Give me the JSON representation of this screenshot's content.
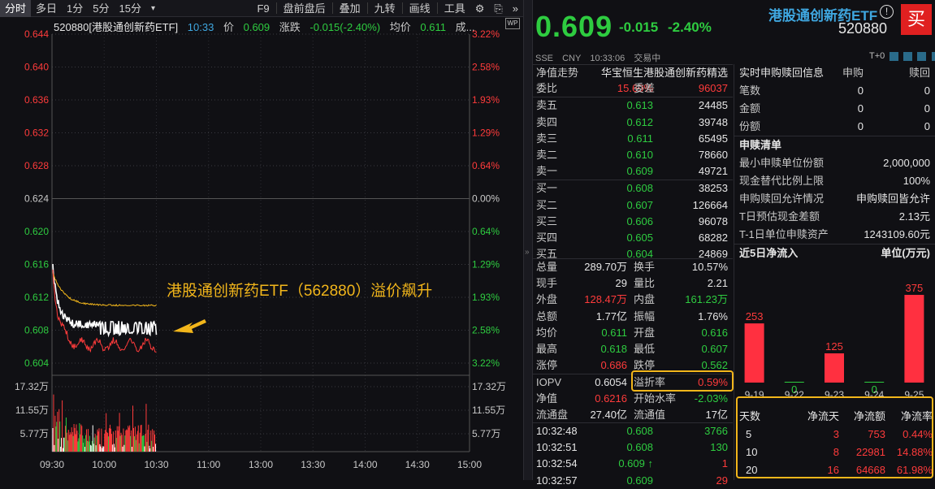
{
  "toolbar": {
    "items": [
      "分时",
      "多日",
      "1分",
      "5分",
      "15分",
      "▾",
      "F9",
      "盘前盘后",
      "叠加",
      "九转",
      "画线",
      "工具",
      "⚙",
      "⎘",
      "»"
    ]
  },
  "chart_info": {
    "code_name": "520880[港股通创新药ETF]",
    "time": "10:33",
    "price_label": "价",
    "price": "0.609",
    "chg_label": "涨跌",
    "chg": "-0.015(-2.40%)",
    "avg_label": "均价",
    "avg": "0.611",
    "vol_label": "成..."
  },
  "annotation": "港股通创新药ETF（562880）溢价飙升",
  "chart_data": {
    "type": "line",
    "price_axis_left": [
      "0.644",
      "0.640",
      "0.636",
      "0.632",
      "0.628",
      "0.624",
      "0.620",
      "0.616",
      "0.612",
      "0.608",
      "0.604"
    ],
    "price_axis_right": [
      "3.22%",
      "2.58%",
      "1.93%",
      "1.29%",
      "0.64%",
      "0.00%",
      "0.64%",
      "1.29%",
      "1.93%",
      "2.58%",
      "3.22%"
    ],
    "volume_axis": [
      "17.32万",
      "11.55万",
      "5.77万"
    ],
    "x_ticks": [
      "09:30",
      "10:00",
      "10:30",
      "11:00",
      "13:00",
      "13:30",
      "14:00",
      "14:30",
      "15:00"
    ],
    "ylim": [
      0.604,
      0.644
    ],
    "prev_close": 0.624,
    "series": [],
    "colors": {
      "up": "#ff3b3b",
      "down": "#2ecc40",
      "neutral": "#ffffff",
      "avg": "#f2b61b"
    }
  },
  "quote": {
    "price": "0.609",
    "change": "-0.015",
    "change_pct": "-2.40%",
    "name": "港股通创新药ETF",
    "code": "520880",
    "buy_label": "买",
    "exchange": "SSE",
    "currency": "CNY",
    "time": "10:33:06",
    "status": "交易中",
    "t0": "T+0"
  },
  "book_header": {
    "left": "净值走势",
    "right": "华宝恒生港股通创新药精选"
  },
  "book_ratio": {
    "l1": "委比",
    "v1": "15.69%",
    "l2": "委差",
    "v2": "96037"
  },
  "asks": [
    {
      "label": "卖五",
      "price": "0.613",
      "vol": "24485"
    },
    {
      "label": "卖四",
      "price": "0.612",
      "vol": "39748"
    },
    {
      "label": "卖三",
      "price": "0.611",
      "vol": "65495"
    },
    {
      "label": "卖二",
      "price": "0.610",
      "vol": "78660"
    },
    {
      "label": "卖一",
      "price": "0.609",
      "vol": "49721"
    }
  ],
  "bids": [
    {
      "label": "买一",
      "price": "0.608",
      "vol": "38253"
    },
    {
      "label": "买二",
      "price": "0.607",
      "vol": "126664"
    },
    {
      "label": "买三",
      "price": "0.606",
      "vol": "96078"
    },
    {
      "label": "买四",
      "price": "0.605",
      "vol": "68282"
    },
    {
      "label": "买五",
      "price": "0.604",
      "vol": "24869"
    }
  ],
  "stats": [
    {
      "l1": "总量",
      "v1": "289.70万",
      "l2": "换手",
      "v2": "10.57%"
    },
    {
      "l1": "现手",
      "v1": "29",
      "l2": "量比",
      "v2": "2.21"
    },
    {
      "l1": "外盘",
      "v1": "128.47万",
      "l2": "内盘",
      "v2": "161.23万"
    },
    {
      "l1": "总额",
      "v1": "1.77亿",
      "l2": "振幅",
      "v2": "1.76%"
    },
    {
      "l1": "均价",
      "v1": "0.611",
      "l2": "开盘",
      "v2": "0.616"
    },
    {
      "l1": "最高",
      "v1": "0.618",
      "l2": "最低",
      "v2": "0.607"
    },
    {
      "l1": "涨停",
      "v1": "0.686",
      "l2": "跌停",
      "v2": "0.562"
    },
    {
      "l1": "IOPV",
      "v1": "0.6054",
      "l2": "溢折率",
      "v2": "0.59%"
    },
    {
      "l1": "净值",
      "v1": "0.6216",
      "l2": "开始水率",
      "v2": "-2.03%"
    },
    {
      "l1": "流通盘",
      "v1": "27.40亿",
      "l2": "流通值",
      "v2": "17亿"
    }
  ],
  "trades": [
    {
      "time": "10:32:48",
      "price": "0.608",
      "vol": "3766"
    },
    {
      "time": "10:32:51",
      "price": "0.608",
      "vol": "130"
    },
    {
      "time": "10:32:54",
      "price": "0.609",
      "vol": "1",
      "arrow": "↑"
    },
    {
      "time": "10:32:57",
      "price": "0.609",
      "vol": "29"
    }
  ],
  "redemption": {
    "title": "实时申购赎回信息",
    "col_sub": "申购",
    "col_red": "赎回",
    "rows": [
      {
        "label": "笔数",
        "sub": "0",
        "red": "0"
      },
      {
        "label": "金额",
        "sub": "0",
        "red": "0"
      },
      {
        "label": "份额",
        "sub": "0",
        "red": "0"
      }
    ]
  },
  "list": {
    "title": "申赎清单",
    "rows": [
      {
        "label": "最小申赎单位份额",
        "value": "2,000,000"
      },
      {
        "label": "现金替代比例上限",
        "value": "100%"
      },
      {
        "label": "申购赎回允许情况",
        "value": "申购赎回皆允许"
      },
      {
        "label": "T日预估现金差额",
        "value": "2.13元"
      },
      {
        "label": "T-1日单位申赎资产",
        "value": "1243109.60元"
      }
    ]
  },
  "flow5": {
    "title": "近5日净流入",
    "unit": "单位(万元)",
    "chart_data": {
      "type": "bar",
      "categories": [
        "9-19",
        "9-22",
        "9-23",
        "9-24",
        "9-25"
      ],
      "values": [
        253,
        0,
        125,
        0,
        375
      ]
    }
  },
  "flow_table": {
    "headers": [
      "天数",
      "净流天",
      "净流额",
      "净流率"
    ],
    "rows": [
      {
        "days": "5",
        "d": "3",
        "amt": "753",
        "rate": "0.44%"
      },
      {
        "days": "10",
        "d": "8",
        "amt": "22981",
        "rate": "14.88%"
      },
      {
        "days": "20",
        "d": "16",
        "amt": "64668",
        "rate": "61.98%"
      }
    ]
  }
}
